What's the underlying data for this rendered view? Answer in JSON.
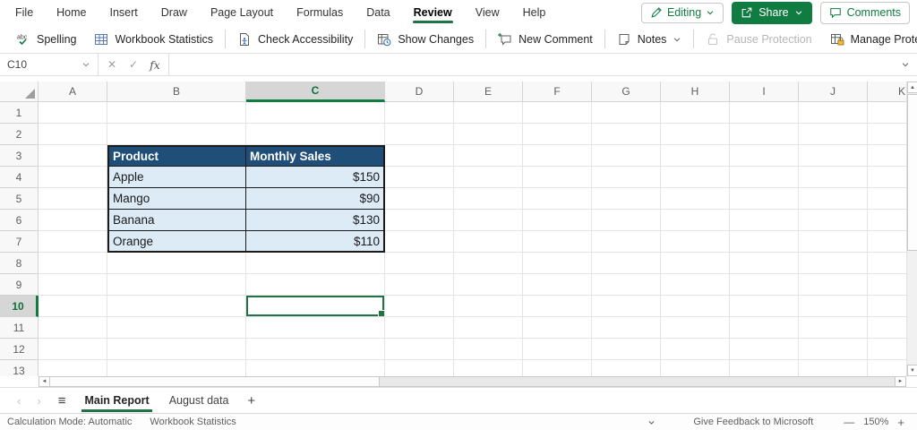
{
  "menu_bar": {
    "tabs": [
      {
        "label": "File",
        "active": false
      },
      {
        "label": "Home",
        "active": false
      },
      {
        "label": "Insert",
        "active": false
      },
      {
        "label": "Draw",
        "active": false
      },
      {
        "label": "Page Layout",
        "active": false
      },
      {
        "label": "Formulas",
        "active": false
      },
      {
        "label": "Data",
        "active": false
      },
      {
        "label": "Review",
        "active": true
      },
      {
        "label": "View",
        "active": false
      },
      {
        "label": "Help",
        "active": false
      }
    ],
    "editing": {
      "label": "Editing"
    },
    "share": {
      "label": "Share"
    },
    "comments": {
      "label": "Comments"
    }
  },
  "ribbon": {
    "buttons": [
      {
        "label": "Spelling",
        "disabled": false
      },
      {
        "label": "Workbook Statistics",
        "disabled": false
      },
      {
        "label": "Check Accessibility",
        "disabled": false
      },
      {
        "label": "Show Changes",
        "disabled": false
      },
      {
        "label": "New Comment",
        "disabled": false
      },
      {
        "label": "Notes",
        "disabled": false,
        "has_dropdown": true
      },
      {
        "label": "Pause Protection",
        "disabled": true
      },
      {
        "label": "Manage Protection",
        "disabled": false
      }
    ],
    "overflow_label": "··"
  },
  "formula_bar": {
    "name_box_value": "C10",
    "formula_value": "",
    "fx_label": "fx",
    "cancel_glyph": "✕",
    "confirm_glyph": "✓"
  },
  "grid": {
    "columns": [
      "A",
      "B",
      "C",
      "D",
      "E",
      "F",
      "G",
      "H",
      "I",
      "J",
      "K"
    ],
    "row_count": 13,
    "selected_cell": "C10",
    "selected_column": "C",
    "selected_row": 10,
    "cells": {
      "B3": {
        "text": "Product",
        "type": "header"
      },
      "C3": {
        "text": "Monthly Sales",
        "type": "header"
      },
      "B4": {
        "text": "Apple",
        "type": "text"
      },
      "C4": {
        "text": "$150",
        "type": "number"
      },
      "B5": {
        "text": "Mango",
        "type": "text"
      },
      "C5": {
        "text": "$90",
        "type": "number"
      },
      "B6": {
        "text": "Banana",
        "type": "text"
      },
      "C6": {
        "text": "$130",
        "type": "number"
      },
      "B7": {
        "text": "Orange",
        "type": "text"
      },
      "C7": {
        "text": "$110",
        "type": "number"
      }
    }
  },
  "sheet_bar": {
    "prev_glyph": "‹",
    "next_glyph": "›",
    "menu_glyph": "≡",
    "tabs": [
      {
        "label": "Main Report",
        "active": true
      },
      {
        "label": "August data",
        "active": false
      }
    ],
    "add_label": "+"
  },
  "status_bar": {
    "calculation_mode": "Calculation Mode: Automatic",
    "workbook_statistics": "Workbook Statistics",
    "feedback": "Give Feedback to Microsoft",
    "zoom_out_glyph": "—",
    "zoom_level": "150%",
    "zoom_in_glyph": "+"
  },
  "colors": {
    "accent_green": "#107C41",
    "tab_underline_green": "#217346",
    "selection_border": "#217346",
    "table_header_bg": "#1F4E79",
    "table_header_text": "#FFFFFF",
    "table_row_bg": "#DDEBF7",
    "table_border": "#1A1A1A",
    "header_selected_bg": "#D6D6D6",
    "header_selected_text": "#0F703B",
    "disabled_text": "#B8B6B4"
  }
}
